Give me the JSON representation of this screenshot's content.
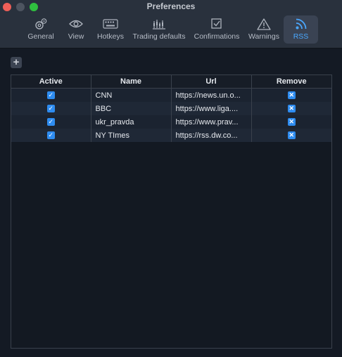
{
  "window": {
    "title": "Preferences"
  },
  "tabs": [
    {
      "label": "General",
      "icon": "gears-icon"
    },
    {
      "label": "View",
      "icon": "eye-icon"
    },
    {
      "label": "Hotkeys",
      "icon": "keyboard-icon"
    },
    {
      "label": "Trading defaults",
      "icon": "chart-bars-icon"
    },
    {
      "label": "Confirmations",
      "icon": "checkbox-icon"
    },
    {
      "label": "Warnings",
      "icon": "warning-icon"
    },
    {
      "label": "RSS",
      "icon": "rss-icon",
      "active": true
    }
  ],
  "toolbar": {
    "add_label": "+"
  },
  "table": {
    "headers": {
      "active": "Active",
      "name": "Name",
      "url": "Url",
      "remove": "Remove"
    },
    "rows": [
      {
        "active": true,
        "name": "CNN",
        "url": "https://news.un.o..."
      },
      {
        "active": true,
        "name": "BBC",
        "url": "https://www.liga...."
      },
      {
        "active": true,
        "name": "ukr_pravda",
        "url": "https://www.prav..."
      },
      {
        "active": true,
        "name": "NY TImes",
        "url": "https://rss.dw.co..."
      }
    ]
  },
  "colors": {
    "accent": "#2e8cf0",
    "active_tab_text": "#4aa8ff",
    "background": "#141a24",
    "titlebar": "#29313d"
  }
}
